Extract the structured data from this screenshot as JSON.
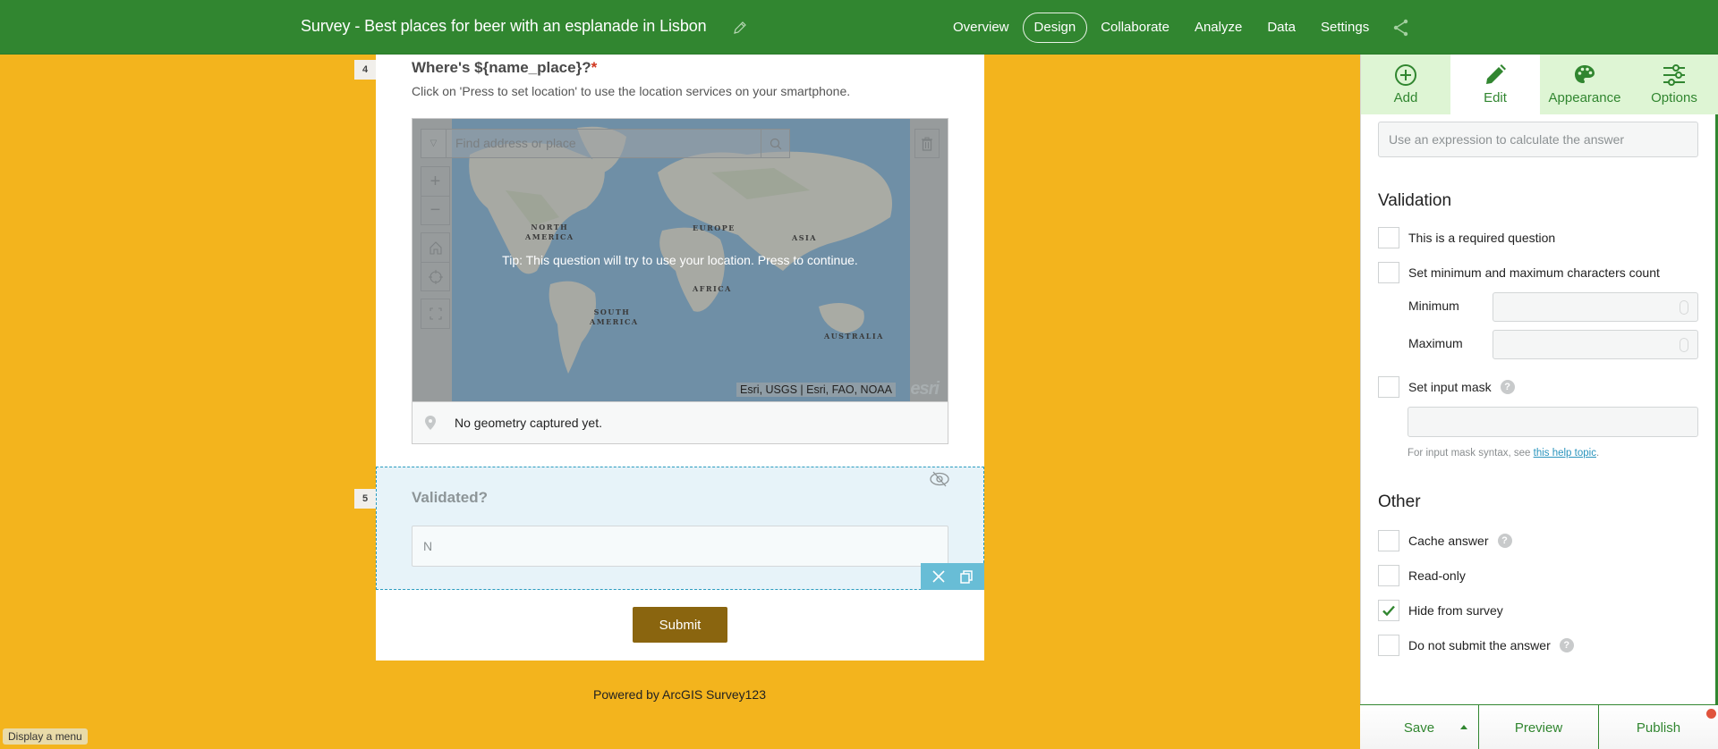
{
  "header": {
    "title": "Survey - Best places for beer with an esplanade in Lisbon",
    "nav": [
      {
        "label": "Overview",
        "active": false
      },
      {
        "label": "Design",
        "active": true
      },
      {
        "label": "Collaborate",
        "active": false
      },
      {
        "label": "Analyze",
        "active": false
      },
      {
        "label": "Data",
        "active": false
      },
      {
        "label": "Settings",
        "active": false
      }
    ],
    "share_icon": "share-icon",
    "edit_icon": "pencil-icon"
  },
  "form": {
    "q4": {
      "number": "4",
      "title": "Where's ${name_place}?",
      "required_mark": "*",
      "hint": "Click on 'Press to set location' to use the location services on your smartphone.",
      "map": {
        "search_placeholder": "Find address or place",
        "tip": "Tip: This question will try to use your location. Press to continue.",
        "labels": {
          "north_america": "NORTH AMERICA",
          "europe": "EUROPE",
          "asia": "ASIA",
          "africa": "AFRICA",
          "south_america": "SOUTH AMERICA",
          "australia": "AUSTRALIA"
        },
        "attribution": "Esri, USGS | Esri, FAO, NOAA",
        "logo": "esri",
        "controls": [
          "zoom-in",
          "zoom-out",
          "home",
          "locate",
          "fullscreen"
        ]
      },
      "geometry_status": "No geometry captured yet."
    },
    "q5": {
      "number": "5",
      "title": "Validated?",
      "value": "N",
      "hidden_icon": "eye-slash-icon"
    },
    "submit_label": "Submit",
    "powered_by": "Powered by ArcGIS Survey123"
  },
  "tooltip": "Display a menu",
  "panel": {
    "tabs": [
      {
        "label": "Add",
        "icon": "plus-circle-icon",
        "active": false
      },
      {
        "label": "Edit",
        "icon": "pencil-icon",
        "active": true
      },
      {
        "label": "Appearance",
        "icon": "palette-icon",
        "active": false
      },
      {
        "label": "Options",
        "icon": "sliders-icon",
        "active": false
      }
    ],
    "calculation_placeholder": "Use an expression to calculate the answer",
    "validation": {
      "heading": "Validation",
      "required": {
        "label": "This is a required question",
        "checked": false
      },
      "minmax": {
        "label": "Set minimum and maximum characters count",
        "checked": false
      },
      "minimum_label": "Minimum",
      "maximum_label": "Maximum",
      "minimum_value": "",
      "maximum_value": "",
      "input_mask": {
        "label": "Set input mask",
        "checked": false,
        "value": ""
      },
      "mask_note": "For input mask syntax, see ",
      "mask_link": "this help topic",
      "mask_note_end": "."
    },
    "other": {
      "heading": "Other",
      "items": [
        {
          "label": "Cache answer",
          "checked": false,
          "help": true
        },
        {
          "label": "Read-only",
          "checked": false,
          "help": false
        },
        {
          "label": "Hide from survey",
          "checked": true,
          "help": false
        },
        {
          "label": "Do not submit the answer",
          "checked": false,
          "help": true
        }
      ]
    },
    "footer": {
      "save": "Save",
      "preview": "Preview",
      "publish": "Publish",
      "publish_has_changes": true
    }
  },
  "colors": {
    "brand_green": "#318630",
    "background": "#f3b41d",
    "submit": "#8a650f",
    "selection": "#68bdd6",
    "tab_bg": "#def5d4",
    "notification": "#e0533c"
  }
}
